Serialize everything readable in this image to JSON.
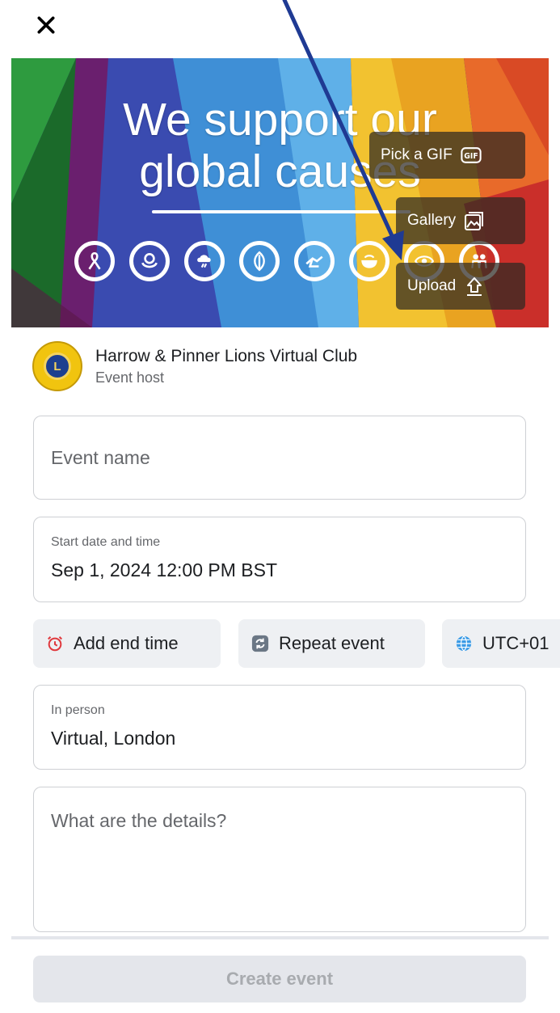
{
  "header": {
    "close_icon": "close-icon"
  },
  "cover": {
    "title_line1": "We support our",
    "title_line2": "global causes",
    "icons": [
      "ribbon-icon",
      "hands-icon",
      "storm-icon",
      "leaf-icon",
      "helping-hand-icon",
      "bowl-icon",
      "eye-icon",
      "children-icon"
    ],
    "pick_gif_label": "Pick a GIF",
    "gallery_label": "Gallery",
    "upload_label": "Upload",
    "annotation_arrow_color": "#1f3a93"
  },
  "host": {
    "name": "Harrow & Pinner Lions Virtual Club",
    "role": "Event host"
  },
  "form": {
    "event_name_placeholder": "Event name",
    "start_label": "Start date and time",
    "start_value": "Sep 1, 2024 12:00 PM BST",
    "location_label": "In person",
    "location_value": "Virtual, London",
    "details_placeholder": "What are the details?"
  },
  "chips": {
    "end_time": "Add end time",
    "repeat": "Repeat event",
    "timezone": "UTC+01"
  },
  "footer": {
    "create_label": "Create event"
  },
  "colors": {
    "accent_arrow": "#1f3a93",
    "chip_bg": "#eef0f3",
    "button_disabled": "#e4e6eb"
  }
}
